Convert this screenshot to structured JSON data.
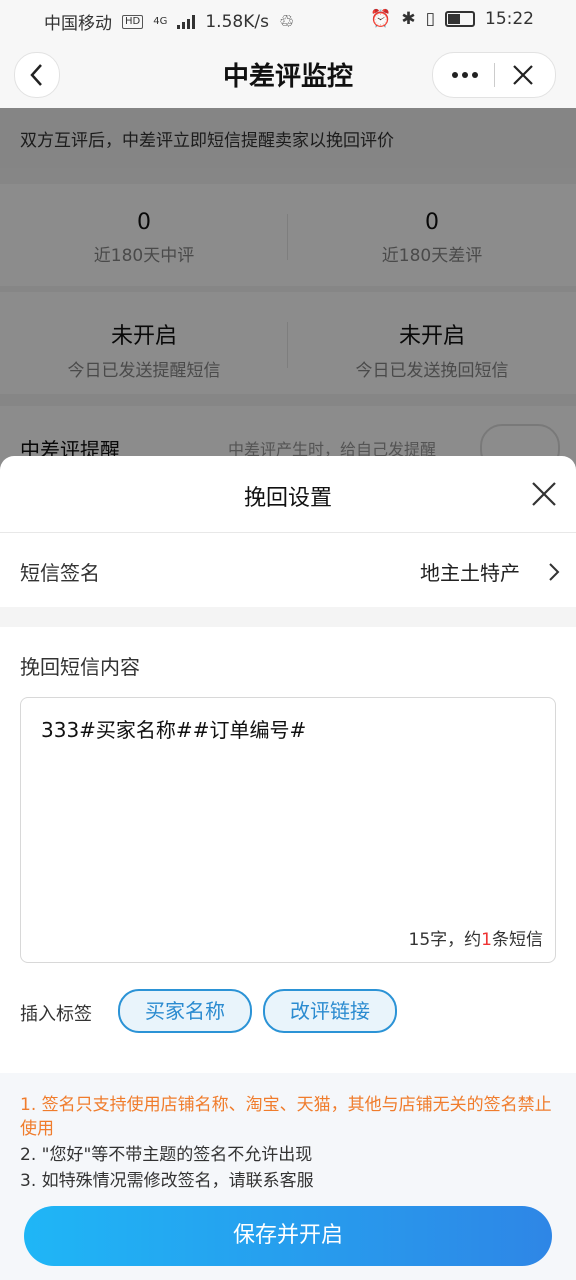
{
  "status_bar": {
    "carrier": "中国移动",
    "hd": "HD",
    "net": "4G",
    "speed": "1.58K/s",
    "time": "15:22"
  },
  "nav": {
    "title": "中差评监控"
  },
  "page": {
    "intro": "双方互评后，中差评立即短信提醒卖家以挽回评价",
    "stats": [
      {
        "value": "0",
        "label": "近180天中评"
      },
      {
        "value": "0",
        "label": "近180天差评"
      }
    ],
    "sms_status": [
      {
        "value": "未开启",
        "label": "今日已发送提醒短信"
      },
      {
        "value": "未开启",
        "label": "今日已发送挽回短信"
      }
    ],
    "remind": {
      "title": "中差评提醒",
      "desc": "中差评产生时，给自己发提醒"
    }
  },
  "sheet": {
    "title": "挽回设置",
    "signature_label": "短信签名",
    "signature_value": "地主土特产",
    "content_label": "挽回短信内容",
    "content_text": "333#买家名称##订单编号#",
    "count_prefix": "15字，约",
    "count_num": "1",
    "count_suffix": "条短信",
    "insert_label": "插入标签",
    "tags": [
      "买家名称",
      "改评链接"
    ],
    "notes": [
      "1. 签名只支持使用店铺名称、淘宝、天猫，其他与店铺无关的签名禁止使用",
      "2. \"您好\"等不带主题的签名不允许出现",
      "3. 如特殊情况需修改签名，请联系客服"
    ],
    "save_label": "保存并开启"
  },
  "colors": {
    "accent": "#2b93d6",
    "warn": "#f07c2c",
    "count_red": "#e33333"
  }
}
